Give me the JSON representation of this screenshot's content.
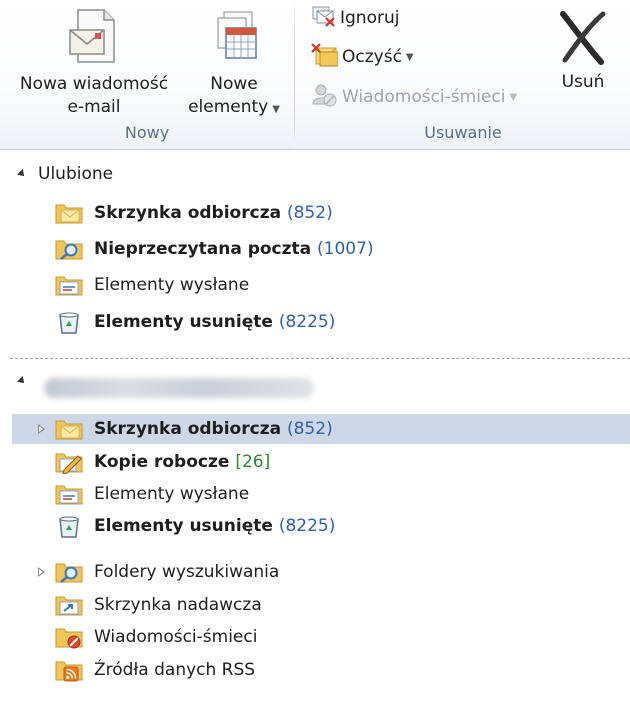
{
  "ribbon": {
    "groups": {
      "new": {
        "label": "Nowy",
        "new_email": {
          "line1": "Nowa wiadomość",
          "line2": "e-mail"
        },
        "new_items": {
          "line1": "Nowe",
          "line2": "elementy"
        }
      },
      "delete": {
        "label": "Usuwanie",
        "ignore": "Ignoruj",
        "cleanup": "Oczyść",
        "junk": "Wiadomości-śmieci",
        "delete": "Usuń"
      }
    }
  },
  "favorites": {
    "title": "Ulubione",
    "items": [
      {
        "name": "Skrzynka odbiorcza",
        "count": "(852)",
        "bold": true,
        "icon": "inbox-icon"
      },
      {
        "name": "Nieprzeczytana poczta",
        "count": "(1007)",
        "bold": true,
        "icon": "search-folder-icon"
      },
      {
        "name": "Elementy wysłane",
        "count": "",
        "bold": false,
        "icon": "sent-items-icon"
      },
      {
        "name": "Elementy usunięte",
        "count": "(8225)",
        "bold": true,
        "icon": "deleted-items-icon"
      }
    ]
  },
  "account": {
    "title_blurred": "",
    "items": [
      {
        "name": "Skrzynka odbiorcza",
        "count": "(852)"
      },
      {
        "name": "Kopie robocze",
        "count": "[26]"
      },
      {
        "name": "Elementy wysłane",
        "count": ""
      },
      {
        "name": "Elementy usunięte",
        "count": "(8225)"
      },
      {
        "name": "Foldery wyszukiwania",
        "count": ""
      },
      {
        "name": "Skrzynka nadawcza",
        "count": ""
      },
      {
        "name": "Wiadomości-śmieci",
        "count": ""
      },
      {
        "name": "Źródła danych RSS",
        "count": ""
      }
    ]
  },
  "colors": {
    "count_blue": "#2f5fb0",
    "count_green": "#2d8a2d",
    "selection": "#cdd7e6"
  }
}
